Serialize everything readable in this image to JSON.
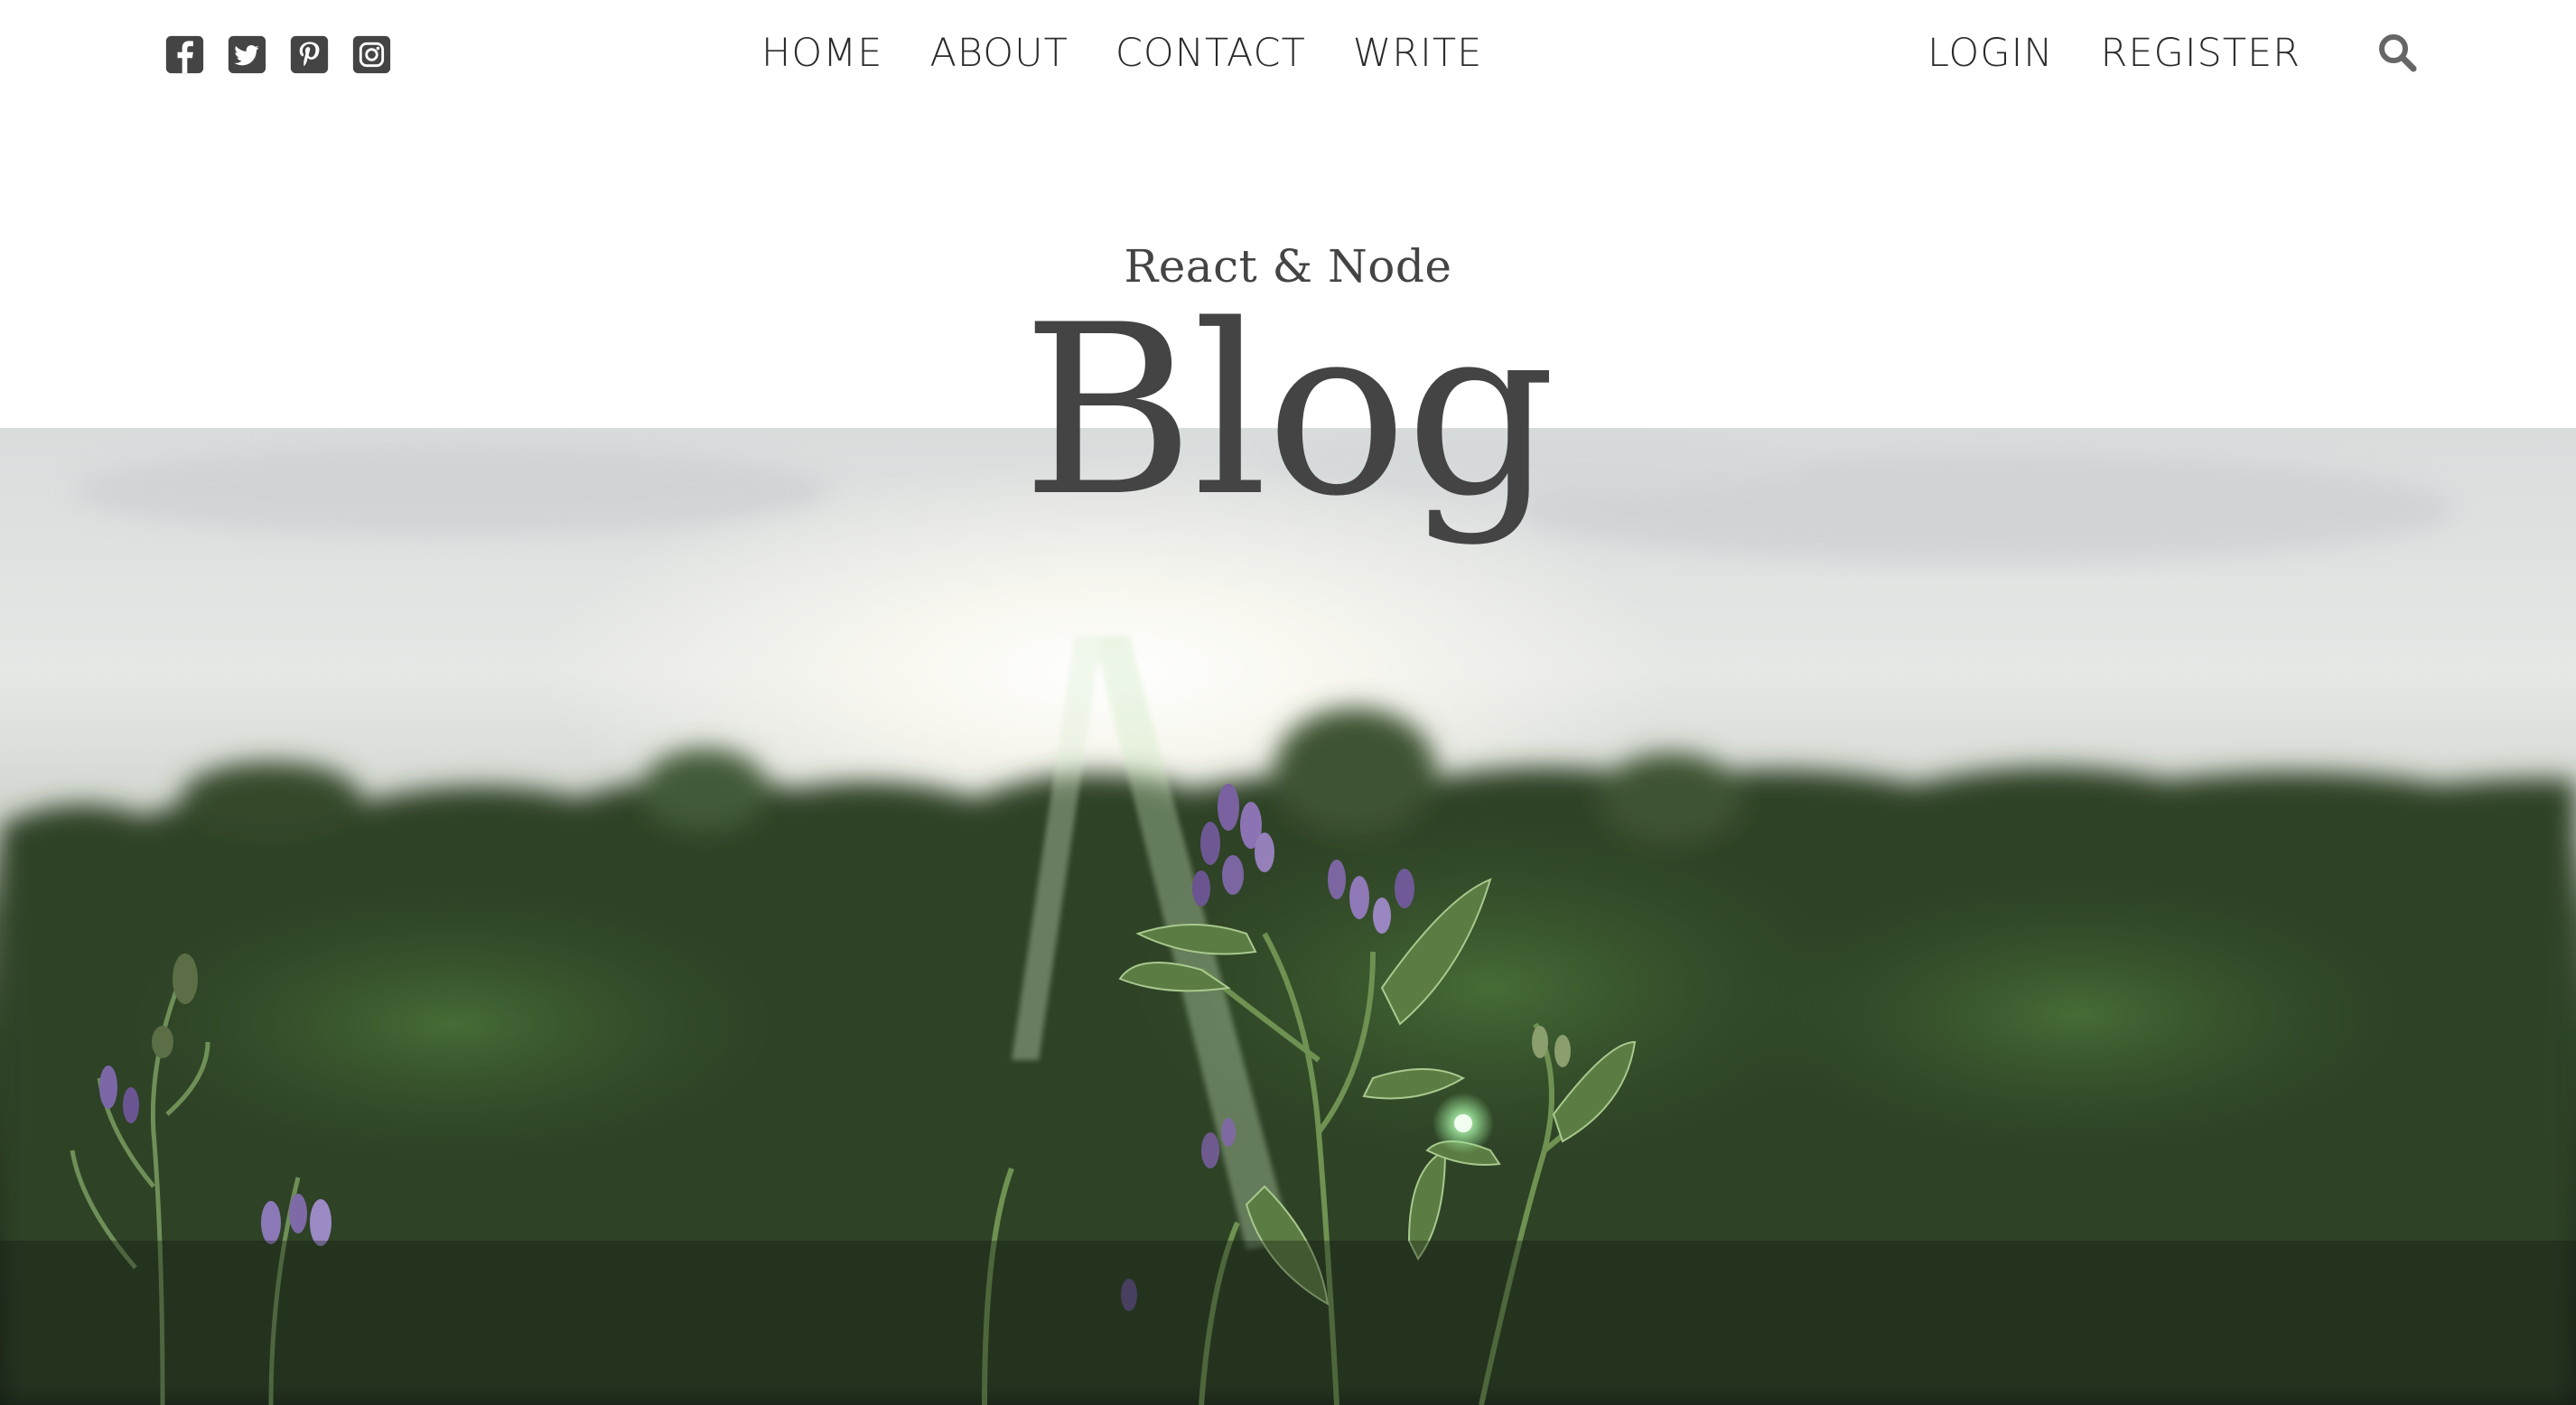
{
  "header": {
    "social_icons": [
      "facebook-square-icon",
      "twitter-square-icon",
      "pinterest-square-icon",
      "instagram-icon"
    ],
    "nav_center": [
      "HOME",
      "ABOUT",
      "CONTACT",
      "WRITE"
    ],
    "nav_right": [
      "LOGIN",
      "REGISTER"
    ],
    "search_icon": "search-icon"
  },
  "hero": {
    "subtitle": "React & Node",
    "title": "Blog",
    "image": "meadow-sunset-flowers"
  },
  "colors": {
    "text": "#444444",
    "nav_text": "#2b2b2b",
    "icon": "#444444",
    "search_icon": "#666666",
    "background": "#ffffff"
  }
}
